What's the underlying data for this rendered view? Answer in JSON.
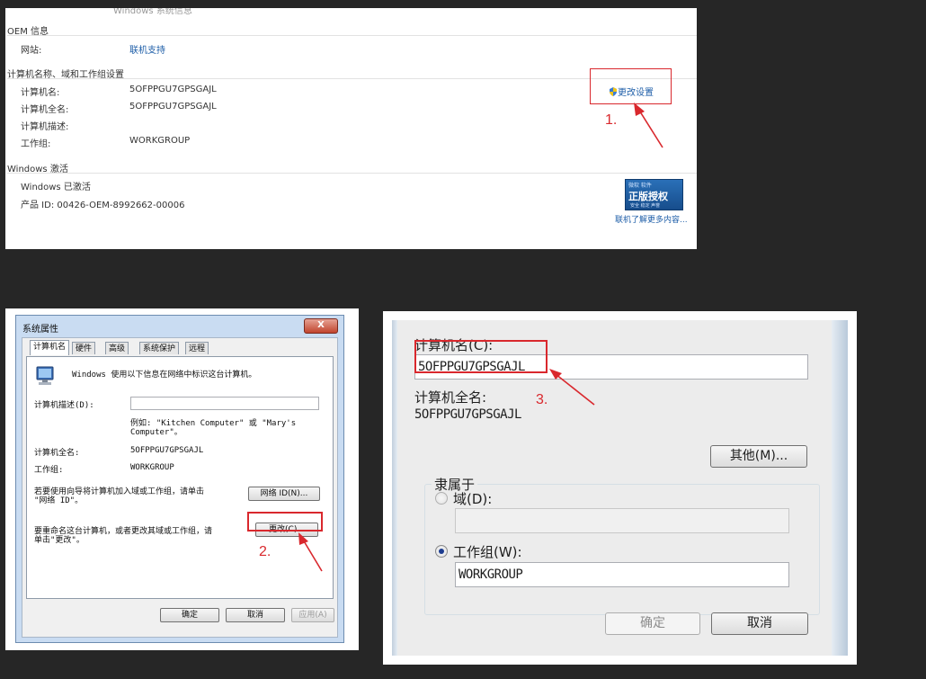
{
  "panel1": {
    "top_cut_text": "Windows 系统信息",
    "oem_section": "OEM 信息",
    "website_label": "网站:",
    "website_link": "联机支持",
    "name_section": "计算机名称、域和工作组设置",
    "computer_name_label": "计算机名:",
    "computer_name_value": "5OFPPGU7GPSGAJL",
    "full_name_label": "计算机全名:",
    "full_name_value": "5OFPPGU7GPSGAJL",
    "description_label": "计算机描述:",
    "workgroup_label": "工作组:",
    "workgroup_value": "WORKGROUP",
    "change_settings_link": "更改设置",
    "activation_section": "Windows 激活",
    "activated_text": "Windows 已激活",
    "product_id_text": "产品 ID: 00426-OEM-8992662-00006",
    "genuine_badge_top": "微软 软件",
    "genuine_badge_main": "正版授权",
    "genuine_badge_bottom": "安全 稳定 声誉",
    "more_info_link": "联机了解更多内容...",
    "step_label": "1."
  },
  "panel2": {
    "title": "系统属性",
    "close_label": "X",
    "tabs": [
      "计算机名",
      "硬件",
      "高级",
      "系统保护",
      "远程"
    ],
    "intro_text": "Windows 使用以下信息在网络中标识这台计算机。",
    "description_label": "计算机描述(D):",
    "example_line1": "例如: \"Kitchen Computer\" 或 \"Mary's",
    "example_line2": "Computer\"。",
    "full_name_label": "计算机全名:",
    "full_name_value": "5OFPPGU7GPSGAJL",
    "workgroup_label": "工作组:",
    "workgroup_value": "WORKGROUP",
    "network_text_line1": "若要使用向导将计算机加入域或工作组，请单击",
    "network_text_line2": "\"网络 ID\"。",
    "network_id_button": "网络 ID(N)...",
    "rename_text_line1": "要重命名这台计算机，或者更改其域或工作组，请",
    "rename_text_line2": "单击\"更改\"。",
    "change_button": "更改(C)...",
    "ok_button": "确定",
    "cancel_button": "取消",
    "apply_button": "应用(A)",
    "step_label": "2."
  },
  "panel3": {
    "computer_name_label": "计算机名(C):",
    "computer_name_value": "5OFPPGU7GPSGAJL",
    "full_name_label": "计算机全名:",
    "full_name_value": "5OFPPGU7GPSGAJL",
    "more_button": "其他(M)...",
    "member_of_label": "隶属于",
    "domain_label": "域(D):",
    "domain_value": "",
    "workgroup_label": "工作组(W):",
    "workgroup_value": "WORKGROUP",
    "ok_button": "确定",
    "cancel_button": "取消",
    "step_label": "3."
  },
  "colors": {
    "background": "#262626",
    "annotation_red": "#d9282d",
    "link_blue": "#1e5ea8"
  }
}
